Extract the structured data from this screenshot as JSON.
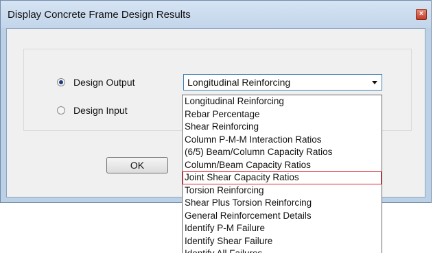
{
  "window": {
    "title": "Display Concrete Frame Design Results",
    "close_glyph": "×"
  },
  "radios": [
    {
      "label": "Design Output",
      "checked": true
    },
    {
      "label": "Design Input",
      "checked": false
    }
  ],
  "select": {
    "value": "Longitudinal Reinforcing",
    "options": [
      "Longitudinal Reinforcing",
      "Rebar Percentage",
      "Shear Reinforcing",
      "Column P-M-M Interaction Ratios",
      "(6/5) Beam/Column Capacity Ratios",
      "Column/Beam Capacity Ratios",
      "Joint Shear Capacity Ratios",
      "Torsion Reinforcing",
      "Shear Plus Torsion Reinforcing",
      "General Reinforcement Details",
      "Identify P-M Failure",
      "Identify Shear Failure",
      "Identify All Failures"
    ],
    "highlighted_option": "Joint Shear Capacity Ratios"
  },
  "buttons": {
    "ok_label": "OK"
  },
  "colors": {
    "highlight_border": "#d9232a",
    "select_border": "#3c7fb1"
  },
  "icons": {
    "close": "close-icon",
    "dropdown": "chevron-down-icon"
  }
}
